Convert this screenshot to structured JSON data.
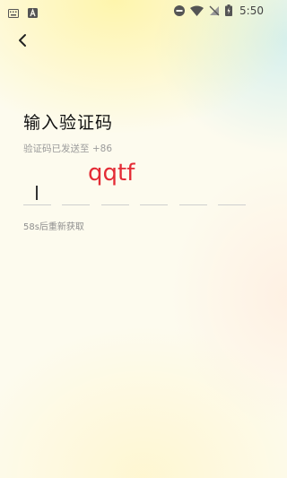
{
  "status_bar": {
    "time": "5:50",
    "icons": [
      "keyboard-icon",
      "a-notification-icon",
      "do-not-disturb-icon",
      "wifi-icon",
      "no-sim-icon",
      "battery-charging-icon"
    ]
  },
  "header": {
    "back_icon": "chevron-left-icon"
  },
  "page": {
    "title": "输入验证码",
    "subtitle": "验证码已发送至 +86",
    "ime_composition": "qqtf",
    "resend_text": "58s后重新获取"
  },
  "code_input": {
    "length": 6,
    "digits": [
      "",
      "",
      "",
      "",
      "",
      ""
    ],
    "active_index": 0
  },
  "colors": {
    "ime_text": "#e42b35",
    "title": "#111111",
    "hint": "#9b9b9b"
  }
}
